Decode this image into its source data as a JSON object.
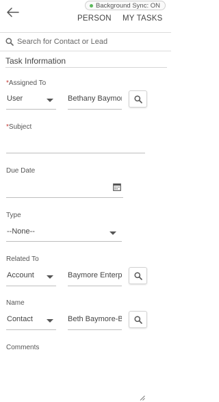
{
  "header": {
    "sync_status": "Background Sync: ON",
    "tabs": [
      {
        "label": "PERSON"
      },
      {
        "label": "MY TASKS"
      }
    ]
  },
  "search": {
    "placeholder": "Search for Contact or Lead"
  },
  "section": {
    "title": "Task Information"
  },
  "form": {
    "assigned_to": {
      "required_mark": "*",
      "label": "Assigned To",
      "type_value": "User",
      "value": "Bethany Baymore"
    },
    "subject": {
      "required_mark": "*",
      "label": "Subject",
      "value": ""
    },
    "due_date": {
      "label": "Due Date",
      "value": ""
    },
    "type": {
      "label": "Type",
      "value": "--None--"
    },
    "related_to": {
      "label": "Related To",
      "type_value": "Account",
      "value": "Baymore Enterprises"
    },
    "name": {
      "label": "Name",
      "type_value": "Contact",
      "value": "Beth Baymore-B"
    },
    "comments": {
      "label": "Comments",
      "value": ""
    }
  },
  "colors": {
    "sync_dot": "#5cb85c",
    "required": "#c23934"
  }
}
